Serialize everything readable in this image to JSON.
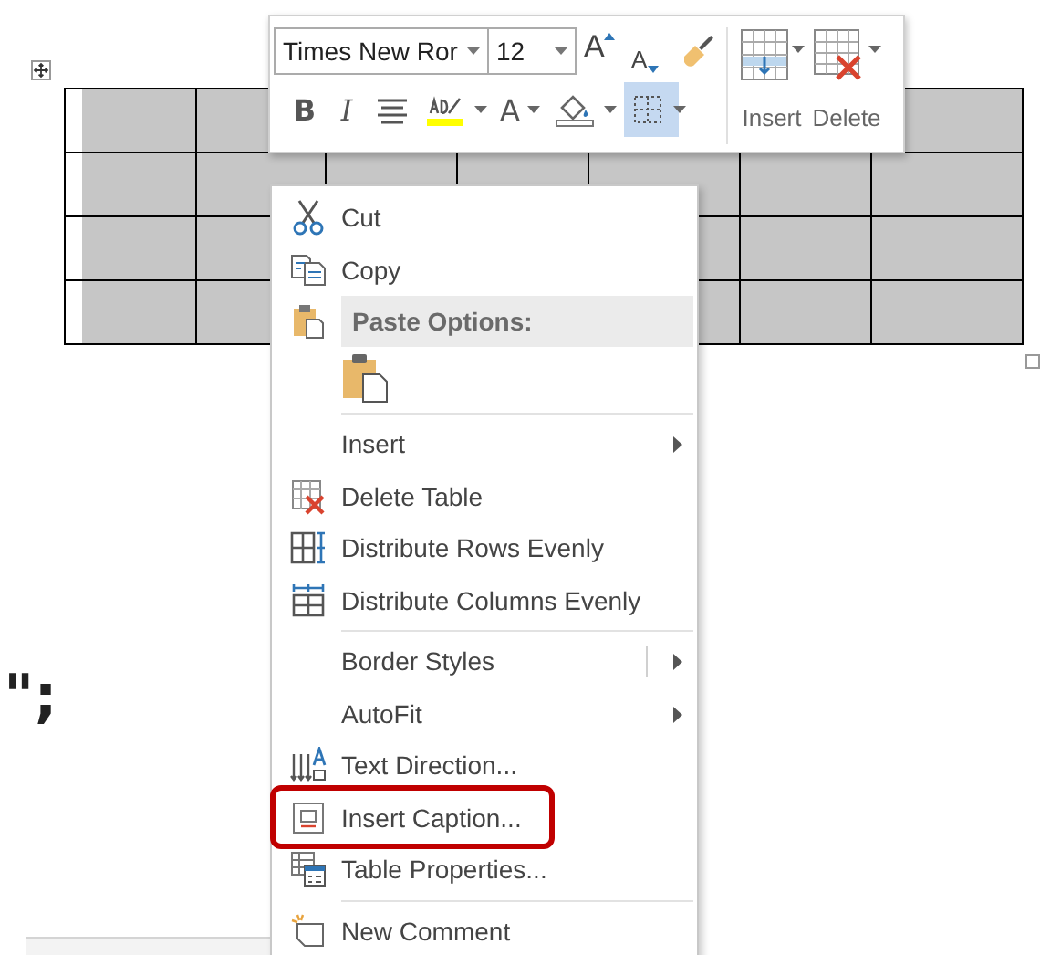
{
  "document": {
    "text": "\";"
  },
  "toolbar": {
    "font": {
      "value": "Times New Ror"
    },
    "size": {
      "value": "12"
    },
    "format_buttons": [
      {
        "kind": "grow",
        "label": "A"
      },
      {
        "kind": "shrink",
        "label": "A"
      },
      {
        "kind": "painter"
      }
    ],
    "style_buttons": [
      {
        "kind": "bold",
        "label": "B",
        "active": false,
        "dropdown": false
      },
      {
        "kind": "italic",
        "label": "I",
        "active": false,
        "dropdown": false
      },
      {
        "kind": "align",
        "active": false,
        "dropdown": false
      },
      {
        "kind": "highlight",
        "active": false,
        "dropdown": true
      },
      {
        "kind": "font-color",
        "label": "A",
        "active": false,
        "dropdown": true
      },
      {
        "kind": "shading",
        "active": false,
        "dropdown": true
      },
      {
        "kind": "borders",
        "active": true,
        "dropdown": true
      }
    ],
    "table_buttons": [
      {
        "kind": "insert",
        "label": "Insert"
      },
      {
        "kind": "delete",
        "label": "Delete"
      }
    ]
  },
  "context_menu": {
    "items": [
      {
        "kind": "item",
        "label": "Cut",
        "submenu": false,
        "split": false,
        "highlighted": false
      },
      {
        "kind": "item",
        "label": "Copy",
        "submenu": false,
        "split": false,
        "highlighted": false
      },
      {
        "kind": "header",
        "label": "Paste Options:"
      },
      {
        "kind": "paste"
      },
      {
        "kind": "separator"
      },
      {
        "kind": "item",
        "label": "Insert",
        "submenu": true,
        "split": false,
        "highlighted": false
      },
      {
        "kind": "item",
        "label": "Delete Table",
        "submenu": false,
        "split": false,
        "highlighted": false
      },
      {
        "kind": "item",
        "label": "Distribute Rows Evenly",
        "submenu": false,
        "split": false,
        "highlighted": false
      },
      {
        "kind": "item",
        "label": "Distribute Columns Evenly",
        "submenu": false,
        "split": false,
        "highlighted": false
      },
      {
        "kind": "separator"
      },
      {
        "kind": "item",
        "label": "Border Styles",
        "submenu": true,
        "split": true,
        "highlighted": false
      },
      {
        "kind": "item",
        "label": "AutoFit",
        "submenu": true,
        "split": false,
        "highlighted": false
      },
      {
        "kind": "item",
        "label": "Text Direction...",
        "submenu": false,
        "split": false,
        "highlighted": false
      },
      {
        "kind": "item",
        "label": "Insert Caption...",
        "submenu": false,
        "split": false,
        "highlighted": true
      },
      {
        "kind": "item",
        "label": "Table Properties...",
        "submenu": false,
        "split": false,
        "highlighted": false
      },
      {
        "kind": "separator"
      },
      {
        "kind": "item",
        "label": "New Comment",
        "submenu": false,
        "split": false,
        "highlighted": false
      }
    ]
  }
}
